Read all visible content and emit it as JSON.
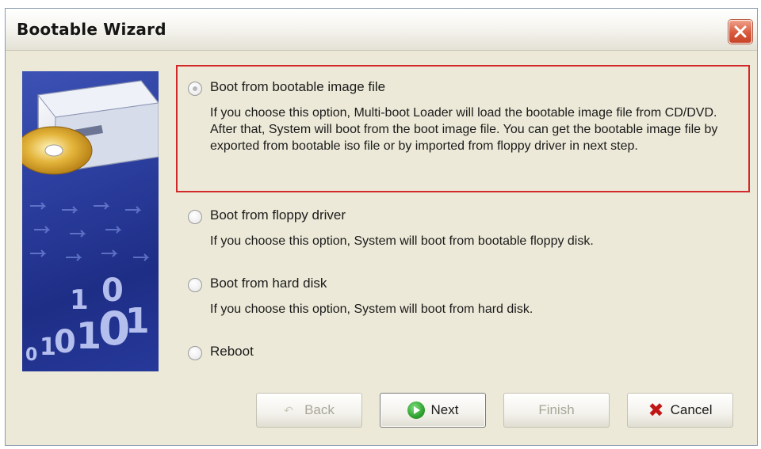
{
  "window": {
    "title": "Bootable Wizard"
  },
  "options": [
    {
      "label": "Boot from bootable image file",
      "description": "If you choose this option, Multi-boot Loader will load the bootable image file from CD/DVD. After that, System will boot from the boot image file. You can get the bootable image file by exported from bootable iso file or by imported from floppy driver in next step.",
      "selected": true
    },
    {
      "label": "Boot from floppy driver",
      "description": "If you choose this option, System will boot from bootable floppy disk.",
      "selected": false
    },
    {
      "label": "Boot from hard disk",
      "description": "If you choose this option, System will boot from hard disk.",
      "selected": false
    },
    {
      "label": "Reboot",
      "description": "",
      "selected": false
    }
  ],
  "buttons": {
    "back": "Back",
    "next": "Next",
    "finish": "Finish",
    "cancel": "Cancel"
  },
  "icons": {
    "close": "close-icon",
    "next": "green-arrow-icon",
    "cancel": "red-x-icon",
    "back": "back-arrow-icon"
  },
  "colors": {
    "highlight": "#d22a2a",
    "dialog_bg": "#ece9d8",
    "close_button": "#d85a3c"
  }
}
